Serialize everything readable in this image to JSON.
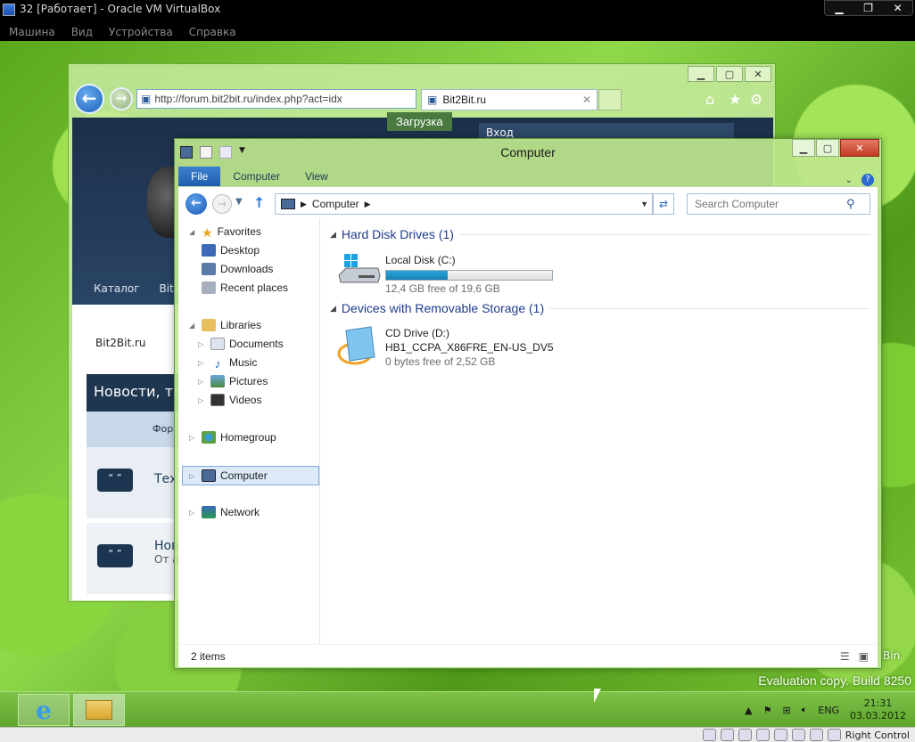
{
  "vbox": {
    "title": "32 [Работает] - Oracle VM VirtualBox",
    "menu": [
      "Машина",
      "Вид",
      "Устройства",
      "Справка"
    ],
    "host_key": "Right Control"
  },
  "browser": {
    "url": "http://forum.bit2bit.ru/index.php?act=idx",
    "tab_title": "Bit2Bit.ru",
    "tooltip": "Загрузка",
    "page": {
      "login": "Вход",
      "menu_1": "Каталог",
      "menu_2": "Bit2B",
      "site": "Bit2Bit.ru",
      "news": "Новости, те",
      "newsbar": "Фор",
      "row1": "Тех",
      "row2a": "Нов",
      "row2b": "От а"
    }
  },
  "explorer": {
    "title": "Computer",
    "ribbon_tabs": [
      "File",
      "Computer",
      "View"
    ],
    "breadcrumb": "Computer",
    "search_placeholder": "Search Computer",
    "nav": {
      "favorites": "Favorites",
      "desktop": "Desktop",
      "downloads": "Downloads",
      "recent": "Recent places",
      "libraries": "Libraries",
      "documents": "Documents",
      "music": "Music",
      "pictures": "Pictures",
      "videos": "Videos",
      "homegroup": "Homegroup",
      "computer": "Computer",
      "network": "Network"
    },
    "groups": {
      "hdd": "Hard Disk Drives (1)",
      "removable": "Devices with Removable Storage (1)"
    },
    "drives": {
      "c_name": "Local Disk (C:)",
      "c_free": "12,4 GB free of 19,6 GB",
      "c_used_fraction": 0.37,
      "d_name": "CD Drive (D:)",
      "d_label": "HB1_CCPA_X86FRE_EN-US_DV5",
      "d_free": "0 bytes free of 2,52 GB"
    },
    "status": "2 items"
  },
  "desktop": {
    "eval": "Evaluation copy. Build 8250",
    "bin": "Bin"
  },
  "taskbar": {
    "lang": "ENG",
    "time": "21:31",
    "date": "03.03.2012"
  }
}
